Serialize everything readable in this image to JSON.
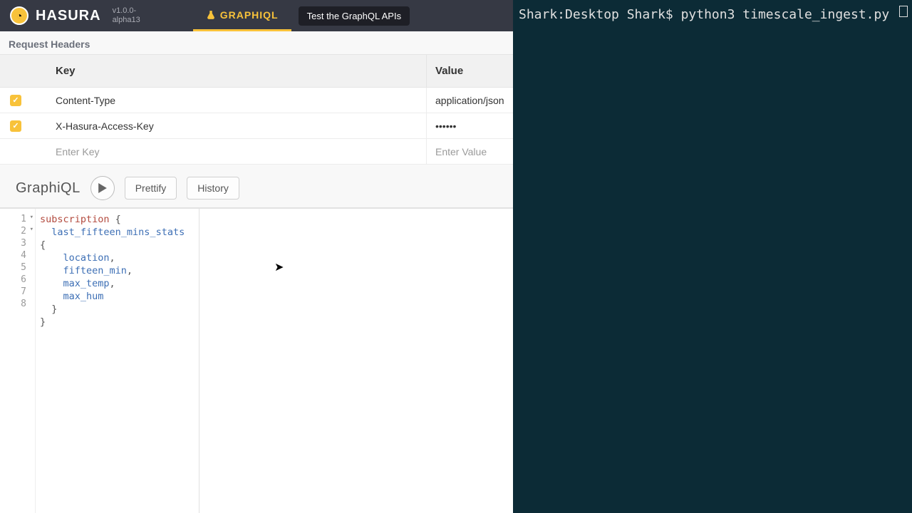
{
  "brand": "HASURA",
  "version_line1": "v1.0.0-",
  "version_line2": "alpha13",
  "tabs": {
    "graphiql": "GRAPHIQL"
  },
  "tooltip": "Test the GraphQL APIs",
  "headers_section": "Request Headers",
  "table": {
    "key_header": "Key",
    "value_header": "Value",
    "rows": [
      {
        "checked": true,
        "key": "Content-Type",
        "value": "application/json"
      },
      {
        "checked": true,
        "key": "X-Hasura-Access-Key",
        "value": "••••••"
      }
    ],
    "placeholder_key": "Enter Key",
    "placeholder_value": "Enter Value"
  },
  "graphiql": {
    "title": "GraphiQL",
    "prettify": "Prettify",
    "history": "History"
  },
  "code_lines": [
    {
      "n": "1",
      "fold": true
    },
    {
      "n": "2",
      "fold": true
    },
    {
      "n": "3"
    },
    {
      "n": "4"
    },
    {
      "n": "5"
    },
    {
      "n": "6"
    },
    {
      "n": "7"
    },
    {
      "n": "8"
    }
  ],
  "query": {
    "kw": "subscription",
    "root": "last_fifteen_mins_stats",
    "fields": [
      "location",
      "fifteen_min",
      "max_temp",
      "max_hum"
    ]
  },
  "terminal": {
    "prompt": "Shark:Desktop Shark$ ",
    "cmd": "python3 timescale_ingest.py"
  }
}
